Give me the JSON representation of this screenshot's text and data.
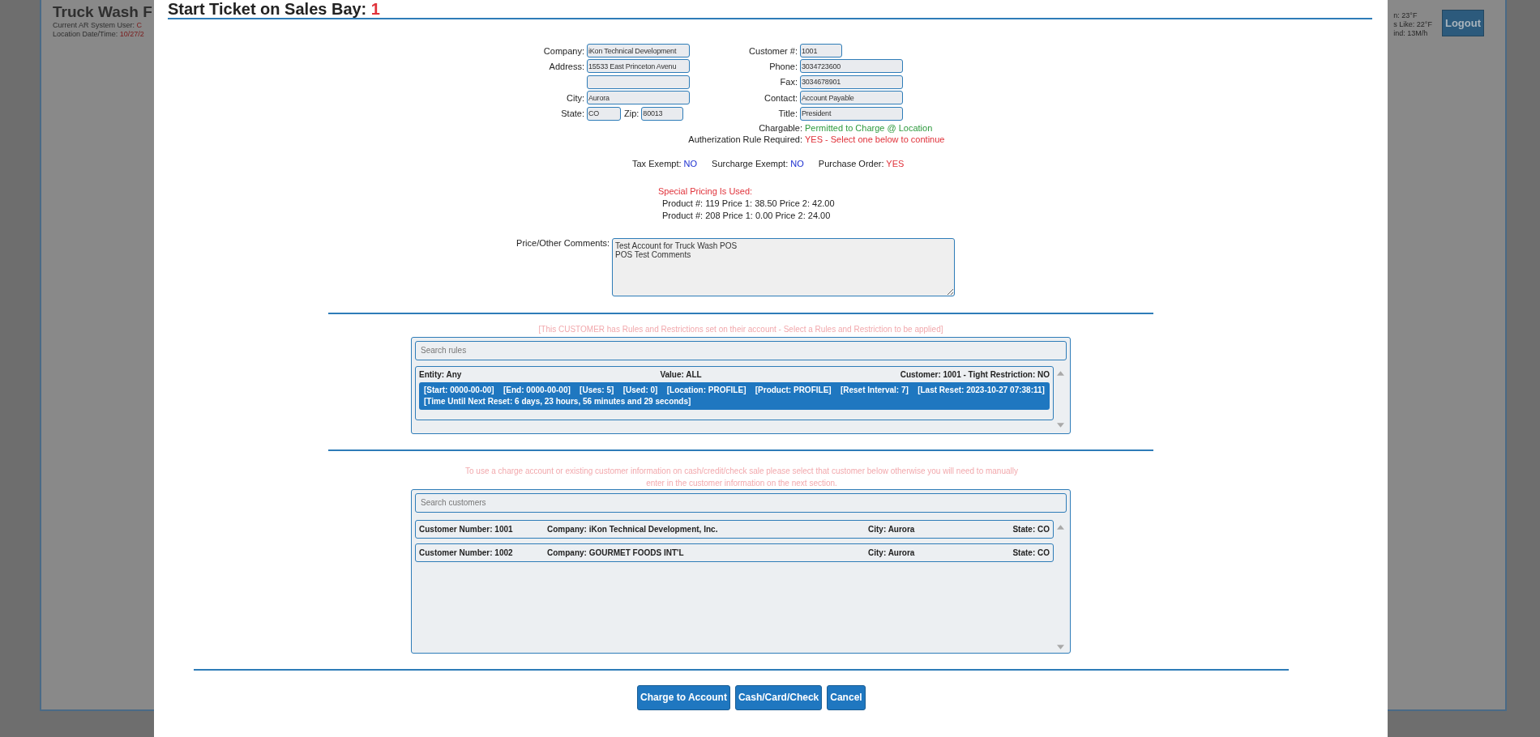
{
  "background_page": {
    "title": "Truck Wash F",
    "user_label": "Current AR System User:",
    "user_value": "C",
    "datetime_label": "Location Date/Time:",
    "datetime_value": "10/27/2",
    "weather": [
      "n: 23°F",
      "s Like: 22°F",
      "ind: 13M/h"
    ],
    "logout_button": "Logout"
  },
  "dialog": {
    "title": "Start Ticket on Sales Bay:",
    "bay": "1",
    "left_fields": [
      {
        "kind": "field",
        "label": "Company:",
        "value": "iKon Technical Development"
      },
      {
        "kind": "field",
        "label": "Address:",
        "value": "15533 East Princeton Avenu"
      },
      {
        "kind": "continuation"
      },
      {
        "kind": "field",
        "label": "City:",
        "value": "Aurora"
      }
    ],
    "state": {
      "label": "State:",
      "value": "CO"
    },
    "zip": {
      "label": "Zip:",
      "value": "80013"
    },
    "right_fields": [
      {
        "label": "Customer #:",
        "value": "1001"
      },
      {
        "label": "Phone:",
        "value": "3034723600"
      },
      {
        "label": "Fax:",
        "value": "3034678901"
      },
      {
        "label": "Contact:",
        "value": "Account Payable"
      },
      {
        "label": "Title:",
        "value": "President"
      }
    ],
    "status_lines": [
      {
        "label": "Chargable:",
        "value": "Permitted to Charge @ Location",
        "kind": "ok"
      },
      {
        "label": "Autherization Rule Required:",
        "value": "YES - Select one below to continue",
        "kind": "alert"
      }
    ],
    "flags": [
      {
        "label": "Tax Exempt:",
        "value": "NO",
        "on": false
      },
      {
        "label": "Surcharge Exempt:",
        "value": "NO",
        "on": false
      },
      {
        "label": "Purchase Order:",
        "value": "YES",
        "on": true
      }
    ],
    "special_pricing": {
      "heading": "Special Pricing Is Used:",
      "products": [
        "Product #: 119 Price 1: 38.50 Price 2: 42.00",
        "Product #: 208 Price 1: 0.00 Price 2: 24.00"
      ]
    },
    "comments": {
      "label": "Price/Other Comments:",
      "value": "Test Account for Truck Wash POS\nPOS Test Comments"
    },
    "rules_notice": "[This CUSTOMER has Rules and Restrictions set on their account - Select a Rules and Restriction to be applied]",
    "rules_search": {
      "placeholder": "Search rules"
    },
    "rules": [
      {
        "entity": "Entity: Any",
        "value": "Value: ALL",
        "customer": "Customer: 1001 - Tight Restriction: NO",
        "selected": true,
        "parts": [
          "[Start: 0000-00-00]",
          "[End: 0000-00-00]",
          "[Uses: 5]",
          "[Used: 0]",
          "[Location: PROFILE]",
          "[Product: PROFILE]",
          "[Reset Interval: 7]",
          "[Last Reset: 2023-10-27 07:38:11]"
        ],
        "next_reset": "[Time Until Next Reset: 6 days, 23 hours, 56 minutes and 29 seconds]"
      }
    ],
    "customers_notice": "To use a charge account or existing customer information on cash/credit/check sale please select that customer below otherwise you will need to manually enter in the customer information on the next section.",
    "customers_search": {
      "placeholder": "Search customers"
    },
    "customers": [
      {
        "number": "Customer Number: 1001",
        "company": "Company: iKon Technical Development, Inc.",
        "city": "City: Aurora",
        "state": "State: CO",
        "selected": false
      },
      {
        "number": "Customer Number: 1002",
        "company": "Company: GOURMET FOODS INT'L",
        "city": "City: Aurora",
        "state": "State: CO",
        "selected": false
      }
    ],
    "buttons": [
      "Charge to Account",
      "Cash/Card/Check",
      "Cancel"
    ]
  }
}
